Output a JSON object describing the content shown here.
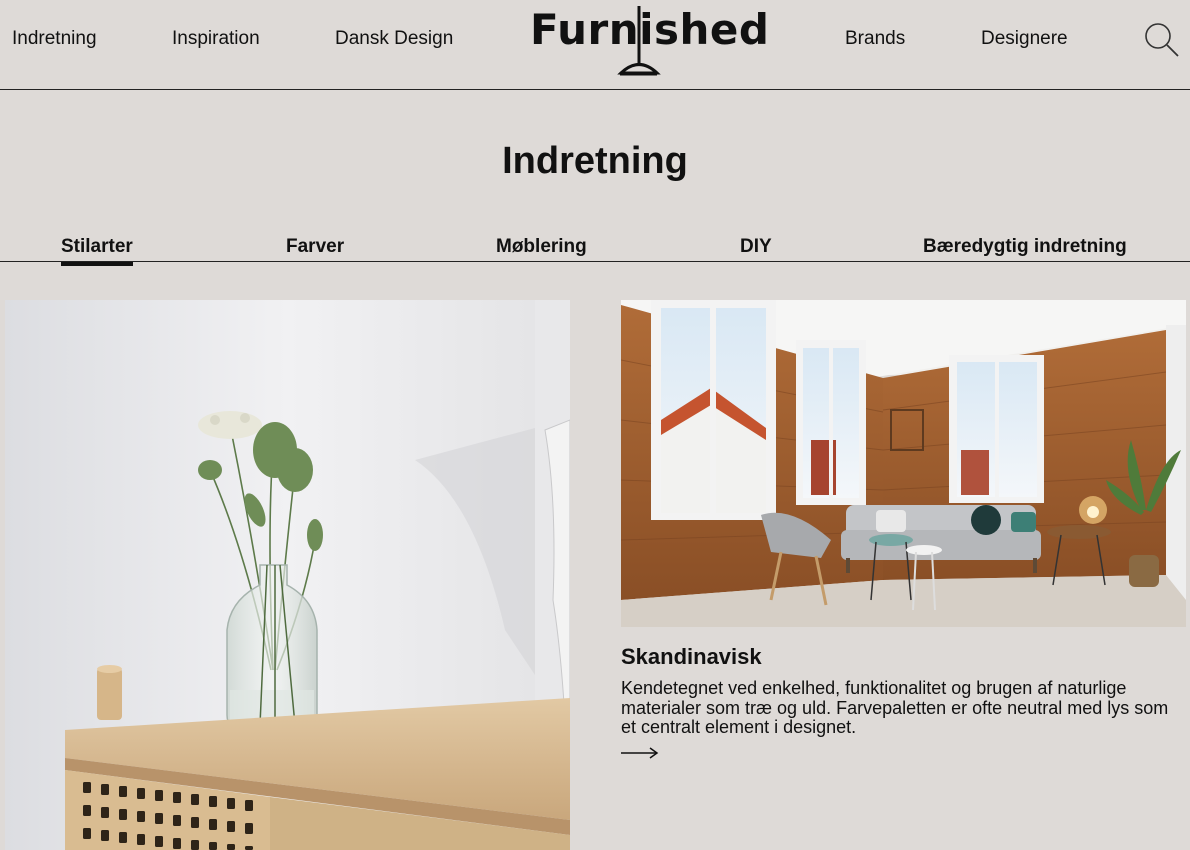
{
  "header": {
    "nav_left": [
      "Indretning",
      "Inspiration",
      "Dansk Design"
    ],
    "logo_text": "Furnished",
    "nav_right": [
      "Brands",
      "Designere"
    ]
  },
  "page": {
    "title": "Indretning"
  },
  "subtabs": {
    "items": [
      "Stilarter",
      "Farver",
      "Møblering",
      "DIY",
      "Bæredygtig indretning"
    ],
    "active": "Stilarter"
  },
  "cards": [
    {
      "title": "Skandinavisk",
      "description": "Kendetegnet ved enkelhed, funktionalitet og brugen af naturlige materialer som træ og uld. Farvepaletten er ofte neutral med lys som et centralt element i designet."
    }
  ],
  "icons": {
    "search": "search-icon",
    "arrow": "arrow-right-icon"
  },
  "colors": {
    "background": "#dedad7",
    "text": "#111111",
    "wood": "#a5683a"
  }
}
